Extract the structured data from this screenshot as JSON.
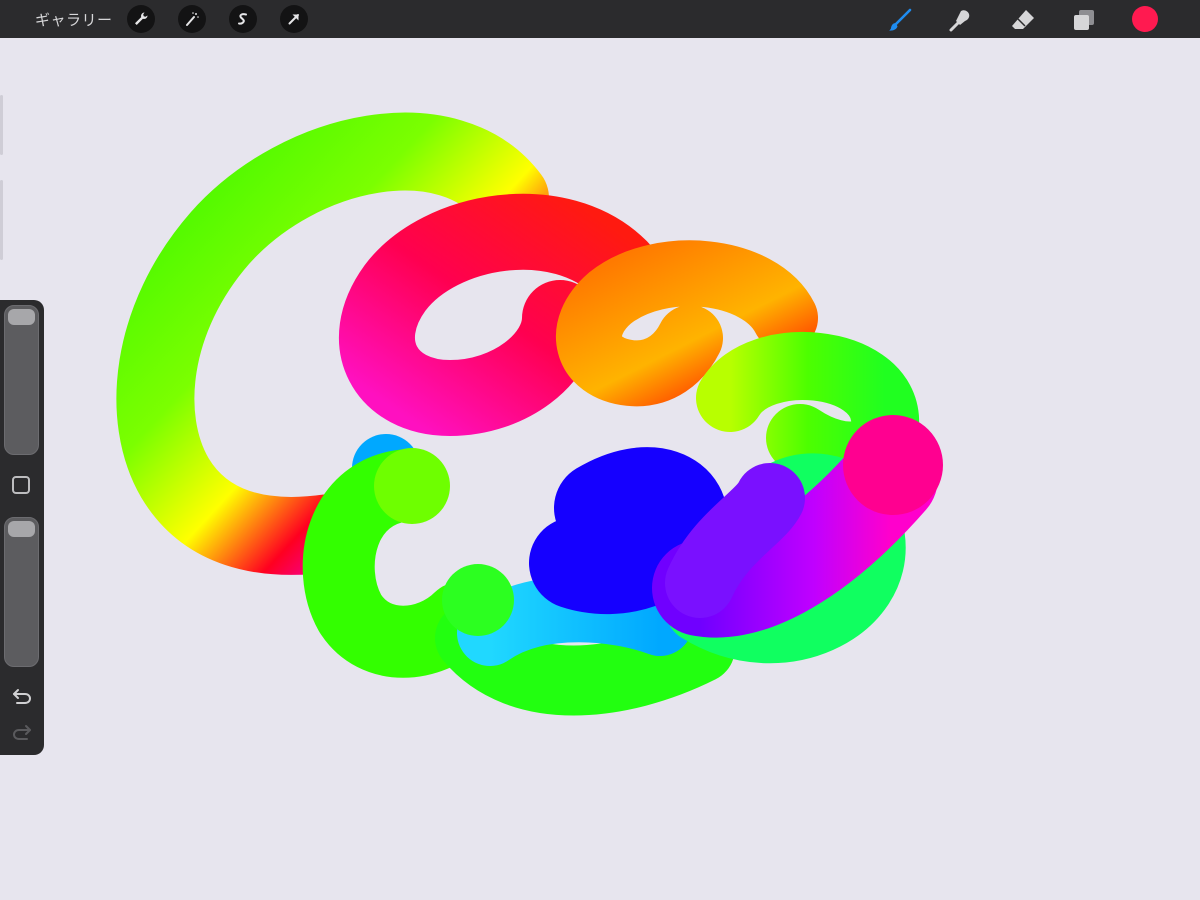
{
  "topbar": {
    "gallery_label": "ギャラリー",
    "left_tools": [
      "wrench-icon",
      "magic-wand-icon",
      "selection-icon",
      "transform-arrow-icon"
    ],
    "right_tools": [
      "brush-icon",
      "smudge-icon",
      "eraser-icon",
      "layers-icon"
    ],
    "active_tool": "brush-icon",
    "current_color": "#ff1a50"
  },
  "sidebar": {
    "brush_size_level": 0,
    "opacity_level": 0,
    "buttons": [
      "modify-square-icon",
      "undo-icon",
      "redo-icon"
    ]
  },
  "colors": {
    "topbar_bg": "#2b2b2d",
    "canvas_bg": "#e7e5ee",
    "active_tool": "#1f8cf0"
  }
}
